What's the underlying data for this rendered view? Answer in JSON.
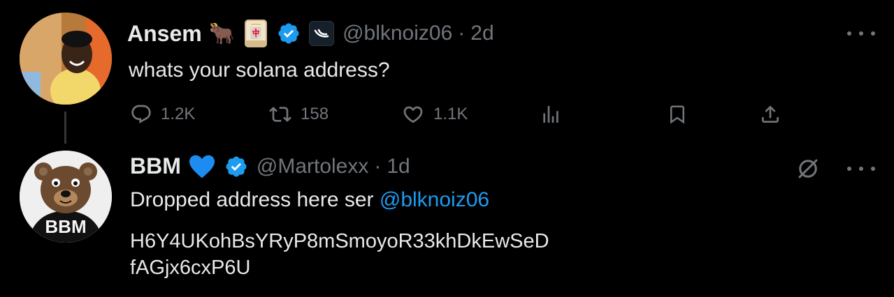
{
  "tweet1": {
    "name": "Ansem",
    "emojis": [
      "🐂",
      "🀄"
    ],
    "handle": "@blknoiz06",
    "separator": "·",
    "time": "2d",
    "text": "whats your solana address?",
    "actions": {
      "replies": "1.2K",
      "retweets": "158",
      "likes": "1.1K"
    }
  },
  "tweet2": {
    "name": "BBM",
    "emoji": "💙",
    "handle": "@Martolexx",
    "separator": "·",
    "time": "1d",
    "text_prefix": "Dropped address here ser ",
    "mention": "@blknoiz06",
    "address_line1": "H6Y4UKohBsYRyP8mSmoyoR33khDkEwSeD",
    "address_line2": "fAGjx6cxP6U",
    "avatar_label": "BBM"
  },
  "colors": {
    "background": "#000000",
    "text": "#e7e9ea",
    "muted": "#71767b",
    "accent": "#1d9bf0"
  },
  "icons": [
    "reply-icon",
    "retweet-icon",
    "like-icon",
    "views-icon",
    "bookmark-icon",
    "share-icon",
    "more-icon",
    "verified-icon",
    "grok-icon"
  ]
}
